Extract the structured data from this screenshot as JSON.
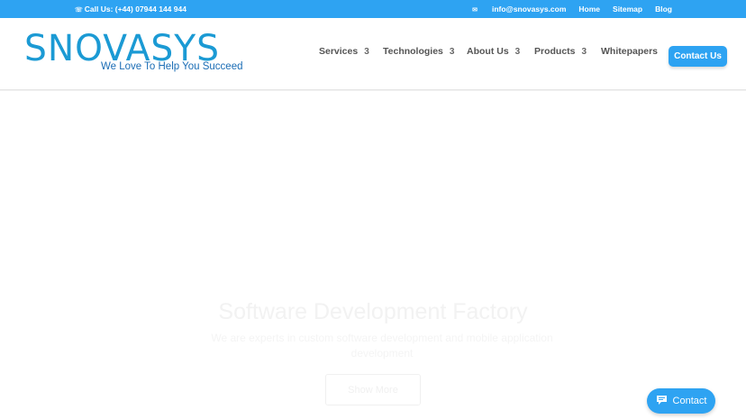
{
  "topbar": {
    "phone_label": "Call Us: (+44) 07944 144 944",
    "email_label": "info@snovasys.com",
    "links": [
      "Home",
      "Sitemap",
      "Blog"
    ]
  },
  "logo": {
    "wordmark": "SNOVASYS",
    "tagline": "We Love To Help You Succeed"
  },
  "nav": {
    "items": [
      {
        "label": "Services",
        "dropdown": "3"
      },
      {
        "label": "Technologies",
        "dropdown": "3"
      },
      {
        "label": "About Us",
        "dropdown": "3"
      },
      {
        "label": "Products",
        "dropdown": "3"
      },
      {
        "label": "Whitepapers"
      }
    ],
    "cta_label": "Contact Us"
  },
  "hero": {
    "title": "Software Development Factory",
    "subtitle": "We are experts in custom software development and mobile application development",
    "button_label": "Show More"
  },
  "chat_widget": {
    "label": "Contact",
    "icon": "chat-bubble-icon"
  },
  "colors": {
    "brand": "#2ea3f2",
    "logo": "#1b9ad4",
    "nav_text": "#555555"
  }
}
